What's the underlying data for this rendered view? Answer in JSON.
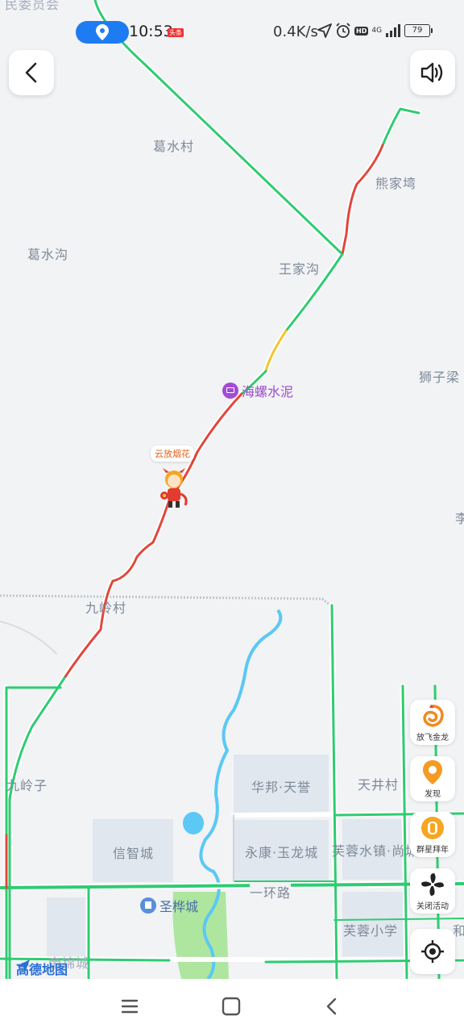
{
  "status_bar": {
    "time": "10:53",
    "toutiao_badge": "头条",
    "net_speed": "0.4K/s",
    "network": "4G",
    "hd": "HD",
    "battery": "79"
  },
  "map": {
    "places": [
      {
        "key": "top_cut",
        "text": "民委员会"
      },
      {
        "key": "geshui_village",
        "text": "葛水村"
      },
      {
        "key": "xiongjiaqi",
        "text": "熊家塆"
      },
      {
        "key": "geshui_gully",
        "text": "葛水沟"
      },
      {
        "key": "wangjiagou",
        "text": "王家沟"
      },
      {
        "key": "shiziliang",
        "text": "狮子梁"
      },
      {
        "key": "li_cut",
        "text": "李"
      },
      {
        "key": "jiuling_village",
        "text": "九岭村"
      },
      {
        "key": "jiulingzi",
        "text": "九岭子"
      },
      {
        "key": "huabang",
        "text": "华邦·天誉"
      },
      {
        "key": "tianjing_village",
        "text": "天井村"
      },
      {
        "key": "xinzhi_city",
        "text": "信智城"
      },
      {
        "key": "yongkang",
        "text": "永康·玉龙城"
      },
      {
        "key": "furong_town",
        "text": "芙蓉水镇·尚城"
      },
      {
        "key": "ring_road",
        "text": "一环路"
      },
      {
        "key": "furong_school",
        "text": "芙蓉小学"
      },
      {
        "key": "he_cut",
        "text": "和"
      },
      {
        "key": "dijin_cut",
        "text": "帝锦城"
      }
    ],
    "poi_cement": "海螺水泥",
    "poi_shenghua": "圣桦城",
    "fireworks_tag": "云放烟花",
    "logo": "高德地图"
  },
  "side_buttons": [
    {
      "key": "dragon",
      "label": "放飞金龙",
      "icon": "dragon-icon"
    },
    {
      "key": "discover",
      "label": "发现",
      "icon": "location-pin-icon"
    },
    {
      "key": "lantern",
      "label": "群星拜年",
      "icon": "lantern-icon"
    },
    {
      "key": "close_activity",
      "label": "关闭活动",
      "icon": "pinwheel-icon"
    }
  ],
  "colors": {
    "road_green": "#2ecc71",
    "road_red": "#e2463b",
    "road_yellow": "#f4c531",
    "river": "#5bc8f5",
    "accent_blue": "#1e7cf2"
  }
}
